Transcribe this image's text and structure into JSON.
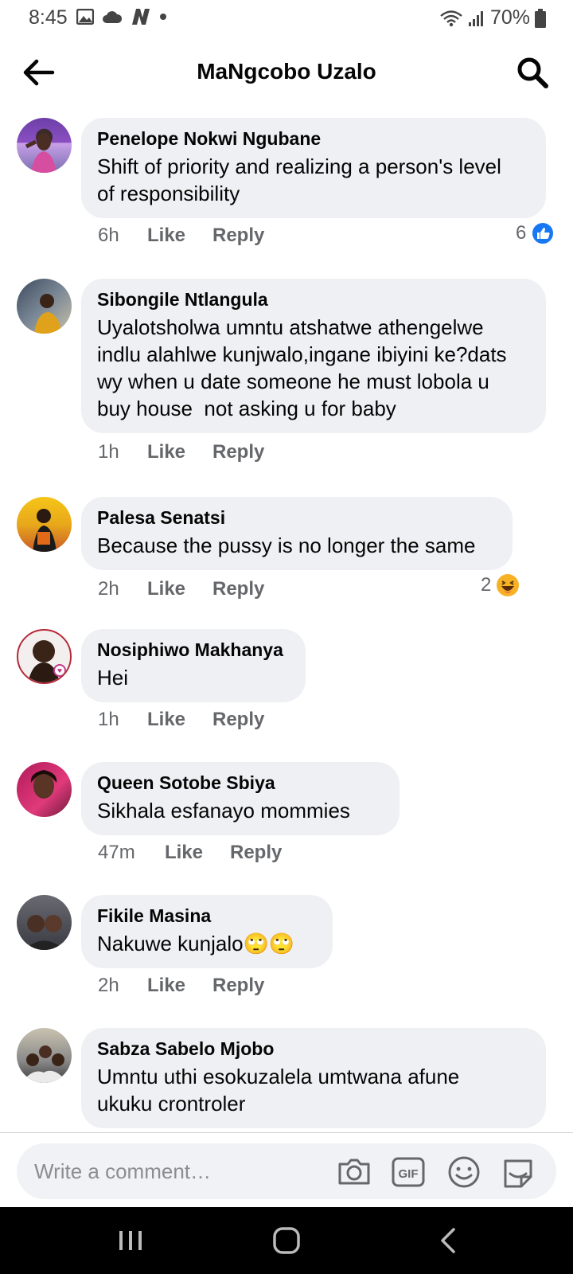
{
  "status_bar": {
    "time": "8:45",
    "battery": "70%",
    "icons_left": [
      "image-icon",
      "cloud-icon",
      "n-app-icon",
      "dot-icon"
    ],
    "icons_right": [
      "wifi-icon",
      "signal-icon",
      "battery-icon"
    ]
  },
  "header": {
    "title": "MaNgcobo Uzalo",
    "back_icon": "arrow-left-icon",
    "search_icon": "search-icon"
  },
  "comments": [
    {
      "author": "Penelope Nokwi Ngubane",
      "text": "Shift of priority and realizing a person's level\nof responsibility",
      "time": "6h",
      "like": "Like",
      "reply": "Reply",
      "reaction_count": "6",
      "reaction_icon": "like-reaction-icon"
    },
    {
      "author": "Sibongile Ntlangula",
      "text": "Uyalotsholwa umntu atshatwe athengelwe\nindlu alahlwe kunjwalo,ingane ibiyini ke?dats\nwy when u date someone he must lobola u\nbuy house  not asking u for baby",
      "time": "1h",
      "like": "Like",
      "reply": "Reply"
    },
    {
      "author": "Palesa Senatsi",
      "text": "Because the pussy is no longer the same",
      "time": "2h",
      "like": "Like",
      "reply": "Reply",
      "reaction_count": "2",
      "reaction_icon": "haha-reaction-icon"
    },
    {
      "author": "Nosiphiwo Makhanya",
      "text": "Hei",
      "time": "1h",
      "like": "Like",
      "reply": "Reply"
    },
    {
      "author": "Queen Sotobe Sbiya",
      "text": "Sikhala esfanayo mommies",
      "time": "47m",
      "like": "Like",
      "reply": "Reply"
    },
    {
      "author": "Fikile Masina",
      "text": "Nakuwe kunjalo🙄🙄",
      "time": "2h",
      "like": "Like",
      "reply": "Reply"
    },
    {
      "author": "Sabza Sabelo Mjobo",
      "text": "Umntu uthi esokuzalela umtwana afune\nukuku crontroler",
      "time": "",
      "like": "",
      "reply": ""
    }
  ],
  "composer": {
    "placeholder": "Write a comment…",
    "icons": [
      "camera-icon",
      "gif-icon",
      "emoji-icon",
      "sticker-icon"
    ]
  },
  "navbar": {
    "icons": [
      "recent-apps-icon",
      "home-icon",
      "back-nav-icon"
    ]
  },
  "colors": {
    "bubble": "#eff0f3",
    "accent": "#1877f2",
    "secondary_text": "#65676b"
  }
}
